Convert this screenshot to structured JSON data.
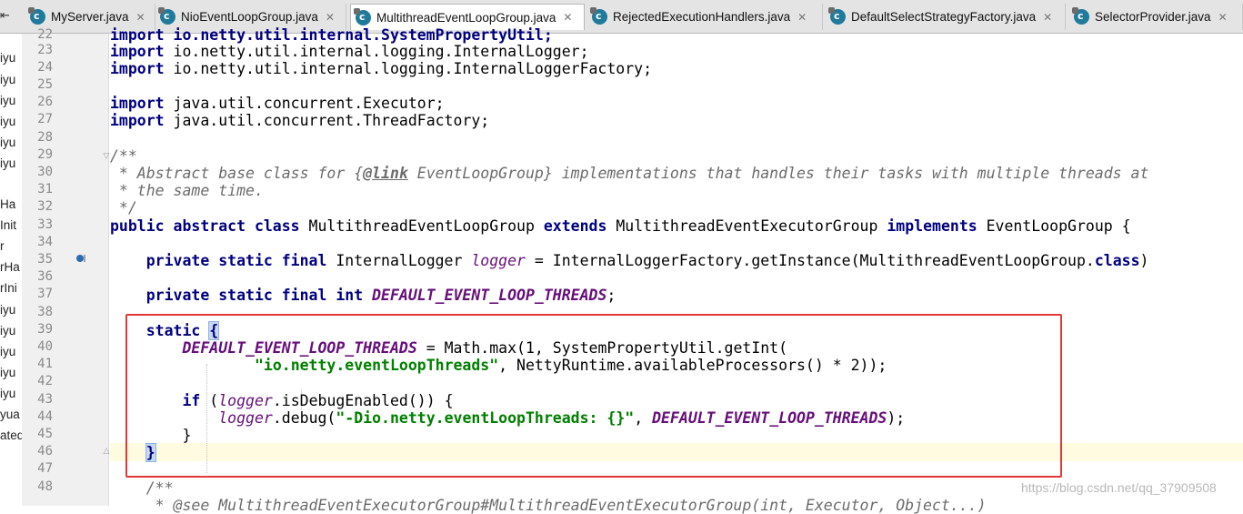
{
  "tabs": [
    {
      "label": "MyServer.java",
      "active": false
    },
    {
      "label": "NioEventLoopGroup.java",
      "active": false
    },
    {
      "label": "MultithreadEventLoopGroup.java",
      "active": true
    },
    {
      "label": "RejectedExecutionHandlers.java",
      "active": false
    },
    {
      "label": "DefaultSelectStrategyFactory.java",
      "active": false
    },
    {
      "label": "SelectorProvider.java",
      "active": false
    }
  ],
  "tab_back_label": "⇤",
  "left_strip": [
    "iyu",
    "iyu",
    "iyu",
    "iyu",
    "iyu",
    "iyu",
    "iyu",
    "Ha",
    "Init",
    "r",
    "rHa",
    "rIni",
    "iyu",
    "iyu",
    "iyu",
    "iyu",
    "iyu",
    "yua",
    "ated"
  ],
  "line_numbers": [
    "22",
    "23",
    "24",
    "25",
    "26",
    "27",
    "28",
    "29",
    "30",
    "31",
    "32",
    "33",
    "34",
    "35",
    "36",
    "37",
    "38",
    "39",
    "40",
    "41",
    "42",
    "43",
    "44",
    "45",
    "46",
    "47",
    "48"
  ],
  "code": {
    "l22": "import io.netty.util.internal.SystemPropertyUtil;",
    "l23a": "import",
    "l23b": " io.netty.util.internal.logging.InternalLogger;",
    "l24a": "import",
    "l24b": " io.netty.util.internal.logging.InternalLoggerFactory;",
    "l26a": "import",
    "l26b": " java.util.concurrent.Executor;",
    "l27a": "import",
    "l27b": " java.util.concurrent.ThreadFactory;",
    "l29": "/**",
    "l30a": " * Abstract base class for {",
    "l30b": "@link",
    "l30c": " EventLoopGroup} implementations that handles their tasks with multiple threads at",
    "l31": " * the same time.",
    "l32": " */",
    "l33a": "public abstract class",
    "l33b": " MultithreadEventLoopGroup ",
    "l33c": "extends",
    "l33d": " MultithreadEventExecutorGroup ",
    "l33e": "implements",
    "l33f": " EventLoopGroup {",
    "l35a": "    private static final",
    "l35b": " InternalLogger ",
    "l35c": "logger",
    "l35d": " = InternalLoggerFactory.getInstance(MultithreadEventLoopGroup.",
    "l35e": "class",
    "l35f": ")",
    "l37a": "    private static final int",
    "l37b": " ",
    "l37c": "DEFAULT_EVENT_LOOP_THREADS",
    "l37d": ";",
    "l39a": "    ",
    "l39b": "static",
    "l39c": " ",
    "l39d": "{",
    "l40a": "        ",
    "l40b": "DEFAULT_EVENT_LOOP_THREADS",
    "l40c": " = Math.max(1, SystemPropertyUtil.getInt(",
    "l41a": "                ",
    "l41b": "\"io.netty.eventLoopThreads\"",
    "l41c": ", NettyRuntime.availableProcessors() * 2));",
    "l43a": "        ",
    "l43b": "if",
    "l43c": " (",
    "l43d": "logger",
    "l43e": ".isDebugEnabled()) {",
    "l44a": "            ",
    "l44b": "logger",
    "l44c": ".debug(",
    "l44d": "\"-Dio.netty.eventLoopThreads: {}\"",
    "l44e": ", ",
    "l44f": "DEFAULT_EVENT_LOOP_THREADS",
    "l44g": ");",
    "l45": "        }",
    "l46a": "    ",
    "l46b": "}",
    "l48": "    /**",
    "l49": "     * @see MultithreadEventExecutorGroup#MultithreadEventExecutorGroup(int, Executor, Object...)"
  },
  "watermark": "https://blog.csdn.net/qq_37909508",
  "colors": {
    "keyword": "#000080",
    "string": "#008000",
    "field": "#660e7a",
    "comment": "#6b6b6b",
    "highlight_box": "#e0393b"
  },
  "icons": {
    "tab_file": "java-class-icon",
    "tab_close": "close-icon",
    "gutter_implements": "implements-icon",
    "gutter_fold": "fold-icon"
  }
}
